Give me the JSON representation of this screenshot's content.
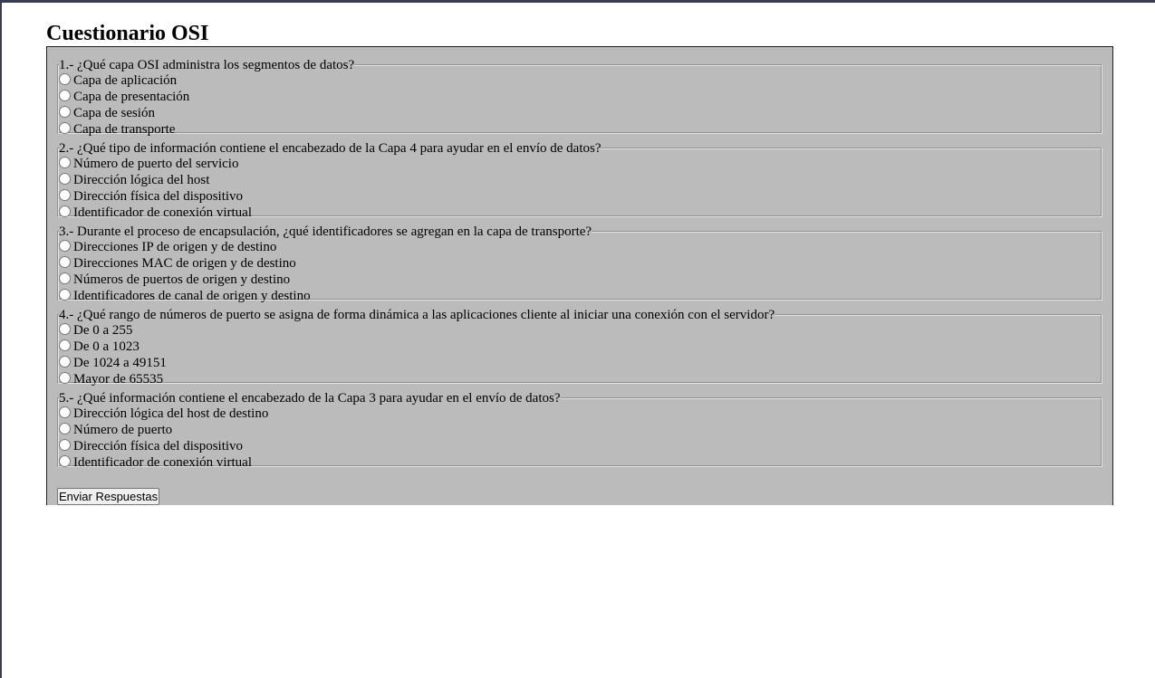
{
  "page": {
    "title": "Cuestionario OSI"
  },
  "questions": [
    {
      "text": "1.- ¿Qué capa OSI administra los segmentos de datos?",
      "options": [
        "Capa de aplicación",
        "Capa de presentación",
        "Capa de sesión",
        "Capa de transporte"
      ]
    },
    {
      "text": "2.- ¿Qué tipo de información contiene el encabezado de la Capa 4 para ayudar en el envío de datos?",
      "options": [
        "Número de puerto del servicio",
        "Dirección lógica del host",
        "Dirección física del dispositivo",
        "Identificador de conexión virtual"
      ]
    },
    {
      "text": "3.- Durante el proceso de encapsulación, ¿qué identificadores se agregan en la capa de transporte?",
      "options": [
        "Direcciones IP de origen y de destino",
        "Direcciones MAC de origen y de destino",
        "Números de puertos de origen y destino",
        "Identificadores de canal de origen y destino"
      ]
    },
    {
      "text": "4.- ¿Qué rango de números de puerto se asigna de forma dinámica a las aplicaciones cliente al iniciar una conexión con el servidor?",
      "options": [
        "De 0 a 255",
        "De 0 a 1023",
        "De 1024 a 49151",
        "Mayor de 65535"
      ]
    },
    {
      "text": "5.- ¿Qué información contiene el encabezado de la Capa 3 para ayudar en el envío de datos?",
      "options": [
        "Dirección lógica del host de destino",
        "Número de puerto",
        "Dirección física del dispositivo",
        "Identificador de conexión virtual"
      ]
    }
  ],
  "form": {
    "submit_label": "Enviar Respuestas",
    "background_color": "#bbbbbb"
  }
}
